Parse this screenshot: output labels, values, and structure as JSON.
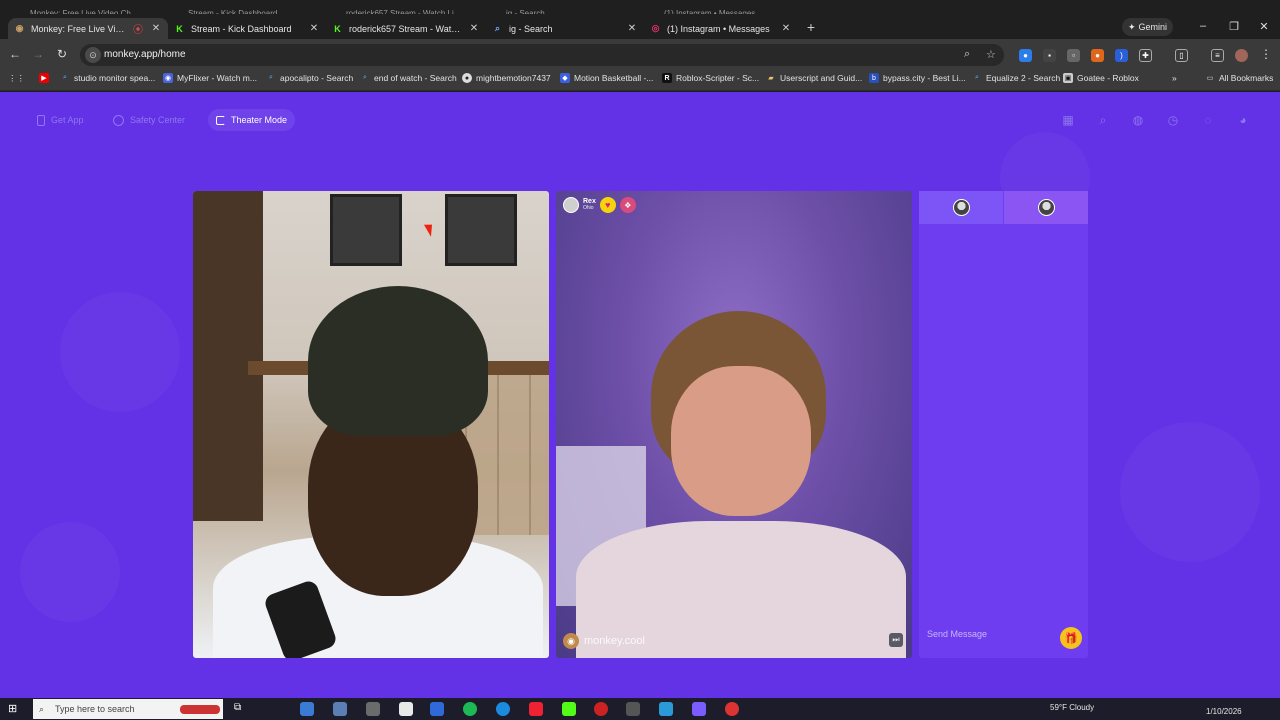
{
  "browser": {
    "background_tabs_row": [
      "Monkey: Free Live Video Ch",
      "Stream - Kick Dashboard",
      "roderick657 Stream - Watch Li",
      "ig - Search",
      "(1) Instagram • Messages"
    ],
    "tabs": [
      {
        "title": "Monkey: Free Live Video Ch",
        "fav_icon": "monkey-icon",
        "active": true
      },
      {
        "title": "Stream - Kick Dashboard",
        "fav_icon": "kick-icon",
        "active": false
      },
      {
        "title": "roderick657 Stream - Watch Li",
        "fav_icon": "kick-icon",
        "active": false
      },
      {
        "title": "ig - Search",
        "fav_icon": "search-icon",
        "active": false
      },
      {
        "title": "(1) Instagram • Messages",
        "fav_icon": "instagram-icon",
        "active": false
      }
    ],
    "gemini_label": "Gemini",
    "url": "monkey.app/home",
    "bookmarks": [
      {
        "label": "studio monitor spea...",
        "icon": "search-icon"
      },
      {
        "label": "MyFlixer - Watch m...",
        "icon": "myflixer-icon"
      },
      {
        "label": "apocalipto - Search",
        "icon": "search-icon"
      },
      {
        "label": "end of watch - Search",
        "icon": "search-icon"
      },
      {
        "label": "mightbemotion7437",
        "icon": "github-icon"
      },
      {
        "label": "Motion Basketball -...",
        "icon": "motion-icon"
      },
      {
        "label": "Roblox-Scripter - Sc...",
        "icon": "roblox-icon"
      },
      {
        "label": "Userscript and Guid...",
        "icon": "folder-icon"
      },
      {
        "label": "bypass.city - Best Li...",
        "icon": "bypass-icon"
      },
      {
        "label": "Equalize 2 - Search",
        "icon": "search-icon"
      },
      {
        "label": "Goatee - Roblox",
        "icon": "roblox-icon"
      }
    ],
    "all_bookmarks_label": "All Bookmarks"
  },
  "page": {
    "top_links": {
      "get_app": "Get App",
      "safety_center": "Safety Center",
      "theater_mode": "Theater Mode"
    },
    "peer": {
      "name": "Rex",
      "location": "Ohio"
    },
    "watermark": "monkey.cool",
    "chat": {
      "placeholder": "Send Message"
    }
  },
  "taskbar": {
    "search_placeholder": "Type here to search",
    "weather": "59°F Cloudy",
    "date": "1/10/2026"
  },
  "colors": {
    "page_bg": "#6331e6",
    "chat_bg": "#6f3df0",
    "gift": "#f6c21b"
  }
}
